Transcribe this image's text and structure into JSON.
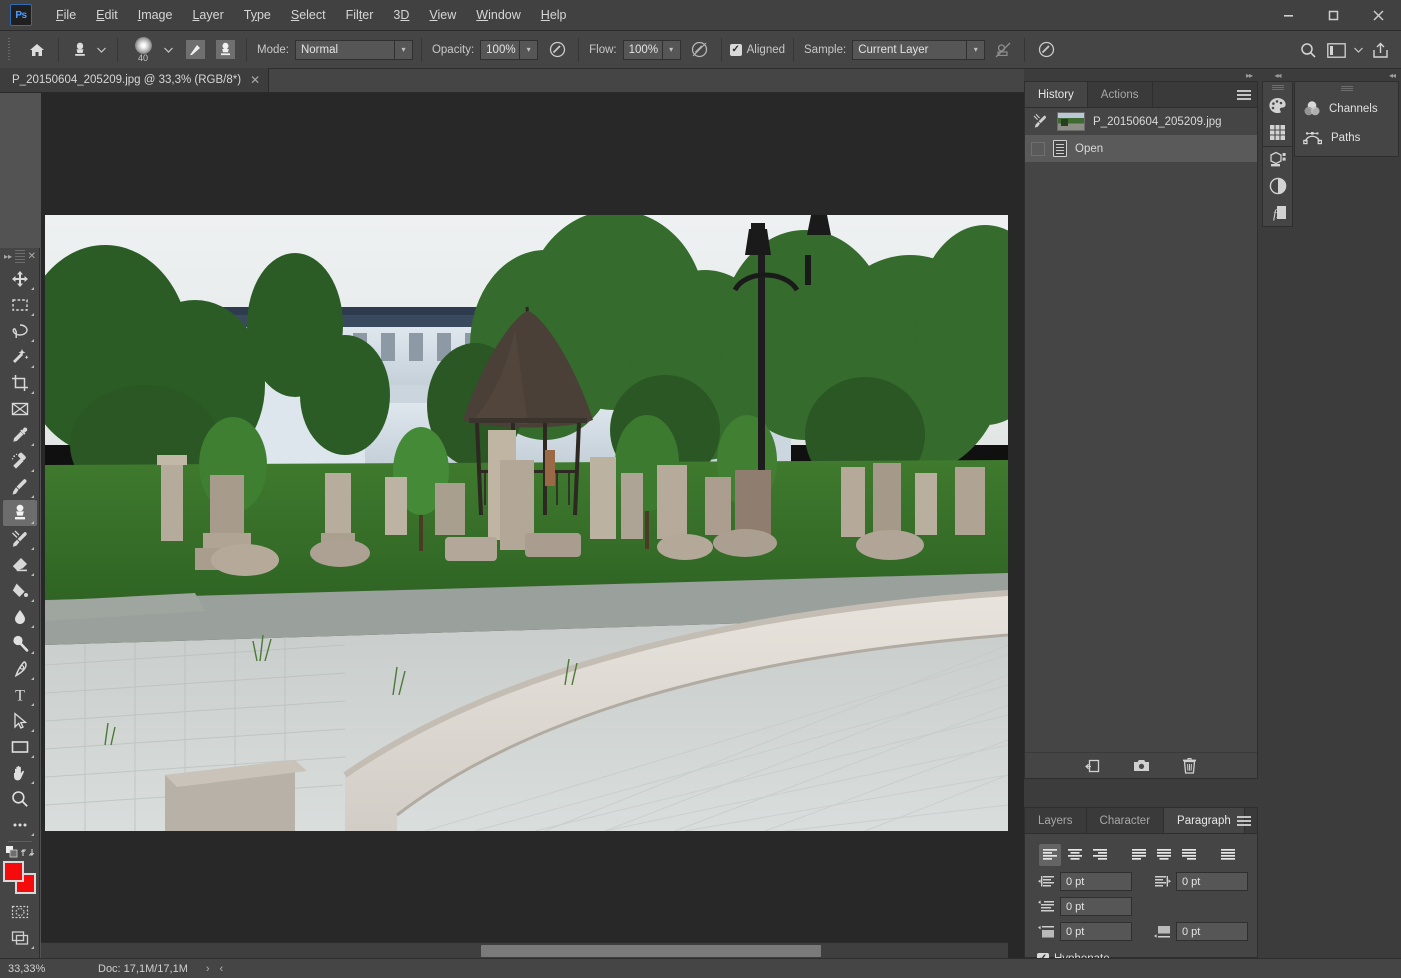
{
  "app": {
    "logo_text": "Ps",
    "window_controls": {
      "minimize": "—",
      "maximize": "▢",
      "close": "✕"
    }
  },
  "menubar": {
    "items": [
      {
        "label": "File",
        "mnemonic": "F"
      },
      {
        "label": "Edit",
        "mnemonic": "E"
      },
      {
        "label": "Image",
        "mnemonic": "I"
      },
      {
        "label": "Layer",
        "mnemonic": "L"
      },
      {
        "label": "Type",
        "mnemonic": "y"
      },
      {
        "label": "Select",
        "mnemonic": "S"
      },
      {
        "label": "Filter",
        "mnemonic": "t"
      },
      {
        "label": "3D",
        "mnemonic": "D"
      },
      {
        "label": "View",
        "mnemonic": "V"
      },
      {
        "label": "Window",
        "mnemonic": "W"
      },
      {
        "label": "Help",
        "mnemonic": "H"
      }
    ]
  },
  "options_bar": {
    "home_icon": "home-icon",
    "tool_preset_icon": "clone-stamp-icon",
    "brush_size": "40",
    "brush_settings_icon": "brush-settings-icon",
    "clone_source_icon": "clone-source-icon",
    "mode_label": "Mode:",
    "mode_value": "Normal",
    "opacity_label": "Opacity:",
    "opacity_value": "100%",
    "opacity_pressure_icon": "pressure-opacity-icon",
    "flow_label": "Flow:",
    "flow_value": "100%",
    "airbrush_icon": "airbrush-icon",
    "aligned_label": "Aligned",
    "aligned_checked": true,
    "sample_label": "Sample:",
    "sample_value": "Current Layer",
    "ignore_adjustment_icon": "ignore-adjustment-layers-icon",
    "angle_pressure_icon": "pressure-size-icon",
    "search_icon": "search-icon",
    "workspace_icon": "workspace-switcher-icon",
    "share_icon": "share-icon"
  },
  "document": {
    "tab_title": "P_20150604_205209.jpg @ 33,3% (RGB/8*)",
    "close_glyph": "✕"
  },
  "toolbar": {
    "collapse_glyph": "▸▸",
    "close_glyph": "✕",
    "tools": [
      {
        "name": "move-tool",
        "icon": "move-icon",
        "active": false,
        "has_flyout": true
      },
      {
        "name": "rectangular-marquee-tool",
        "icon": "marquee-icon",
        "active": false,
        "has_flyout": true
      },
      {
        "name": "lasso-tool",
        "icon": "lasso-icon",
        "active": false,
        "has_flyout": true
      },
      {
        "name": "object-selection-tool",
        "icon": "magic-wand-icon",
        "active": false,
        "has_flyout": true
      },
      {
        "name": "crop-tool",
        "icon": "crop-icon",
        "active": false,
        "has_flyout": true
      },
      {
        "name": "frame-tool",
        "icon": "frame-icon",
        "active": false,
        "has_flyout": false
      },
      {
        "name": "eyedropper-tool",
        "icon": "eyedropper-icon",
        "active": false,
        "has_flyout": true
      },
      {
        "name": "spot-healing-brush-tool",
        "icon": "healing-brush-icon",
        "active": false,
        "has_flyout": true
      },
      {
        "name": "brush-tool",
        "icon": "brush-icon",
        "active": false,
        "has_flyout": true
      },
      {
        "name": "clone-stamp-tool",
        "icon": "clone-stamp-icon",
        "active": true,
        "has_flyout": true
      },
      {
        "name": "history-brush-tool",
        "icon": "history-brush-icon",
        "active": false,
        "has_flyout": true
      },
      {
        "name": "eraser-tool",
        "icon": "eraser-icon",
        "active": false,
        "has_flyout": true
      },
      {
        "name": "gradient-tool",
        "icon": "paint-bucket-icon",
        "active": false,
        "has_flyout": true
      },
      {
        "name": "blur-tool",
        "icon": "blur-drop-icon",
        "active": false,
        "has_flyout": true
      },
      {
        "name": "dodge-tool",
        "icon": "dodge-icon",
        "active": false,
        "has_flyout": true
      },
      {
        "name": "pen-tool",
        "icon": "pen-icon",
        "active": false,
        "has_flyout": true
      },
      {
        "name": "type-tool",
        "icon": "type-t-icon",
        "active": false,
        "has_flyout": true
      },
      {
        "name": "path-selection-tool",
        "icon": "path-arrow-icon",
        "active": false,
        "has_flyout": true
      },
      {
        "name": "rectangle-tool",
        "icon": "rectangle-icon",
        "active": false,
        "has_flyout": true
      },
      {
        "name": "hand-tool",
        "icon": "hand-icon",
        "active": false,
        "has_flyout": true
      },
      {
        "name": "zoom-tool",
        "icon": "zoom-magnifier-icon",
        "active": false,
        "has_flyout": false
      },
      {
        "name": "edit-toolbar-tool",
        "icon": "ellipsis-icon",
        "active": false,
        "has_flyout": true
      }
    ],
    "default_colors_icon": "default-colors-icon",
    "swap_colors_icon": "swap-colors-icon",
    "foreground_color": "#f50b0b",
    "background_color": "#f50b0b",
    "quick_mask_icon": "quick-mask-icon",
    "screen_mode_icon": "screen-mode-icon"
  },
  "history_panel": {
    "tabs": [
      {
        "label": "History",
        "active": true
      },
      {
        "label": "Actions",
        "active": false
      }
    ],
    "menu_icon": "panel-menu-icon",
    "snapshot": {
      "label": "P_20150604_205209.jpg",
      "icon": "snapshot-thumb"
    },
    "states": [
      {
        "label": "Open",
        "selected": true,
        "icon": "open-document-icon"
      }
    ],
    "footer_buttons": [
      {
        "name": "new-document-from-state-button",
        "icon": "new-doc-from-state-icon"
      },
      {
        "name": "new-snapshot-button",
        "icon": "camera-icon"
      },
      {
        "name": "delete-state-button",
        "icon": "trash-icon"
      }
    ]
  },
  "icon_rail": {
    "collapse_glyph": "◂◂",
    "icons": [
      {
        "name": "color-panel-icon",
        "icon": "color-palette-icon"
      },
      {
        "name": "swatches-panel-icon",
        "icon": "swatches-grid-icon"
      },
      {
        "name": "adjustments-panel-icon",
        "icon": "adjustments-icon"
      },
      {
        "name": "properties-panel-icon",
        "icon": "half-circle-icon"
      },
      {
        "name": "styles-panel-icon",
        "icon": "fx-icon"
      }
    ]
  },
  "named_rail": {
    "collapse_glyph": "◂◂",
    "items": [
      {
        "label": "Channels",
        "icon": "channels-icon"
      },
      {
        "label": "Paths",
        "icon": "paths-icon"
      }
    ]
  },
  "paragraph_panel": {
    "tabs": [
      {
        "label": "Layers",
        "active": false
      },
      {
        "label": "Character",
        "active": false
      },
      {
        "label": "Paragraph",
        "active": true
      }
    ],
    "menu_icon": "panel-menu-icon",
    "alignment_buttons": [
      {
        "name": "align-left-button",
        "active": true
      },
      {
        "name": "align-center-button",
        "active": false
      },
      {
        "name": "align-right-button",
        "active": false
      },
      {
        "name": "justify-last-left-button",
        "active": false
      },
      {
        "name": "justify-last-center-button",
        "active": false
      },
      {
        "name": "justify-last-right-button",
        "active": false
      },
      {
        "name": "justify-all-button",
        "active": false
      }
    ],
    "fields": {
      "indent_left_margin": "0 pt",
      "indent_right_margin": "0 pt",
      "indent_first_line": "0 pt",
      "space_before_paragraph": "0 pt",
      "space_after_paragraph": "0 pt"
    },
    "hyphenate_label": "Hyphenate",
    "hyphenate_checked": true
  },
  "status_bar": {
    "zoom": "33,33%",
    "doc_info": "Doc: 17,1M/17,1M",
    "expand_glyph": "›",
    "collapse_glyph": "‹"
  },
  "canvas": {
    "image_alt": "Photo of a lapidarium park with ancient stone monuments, a gazebo with conical metal roof, trees, a white wall building and street lamps over a paved walkway."
  }
}
